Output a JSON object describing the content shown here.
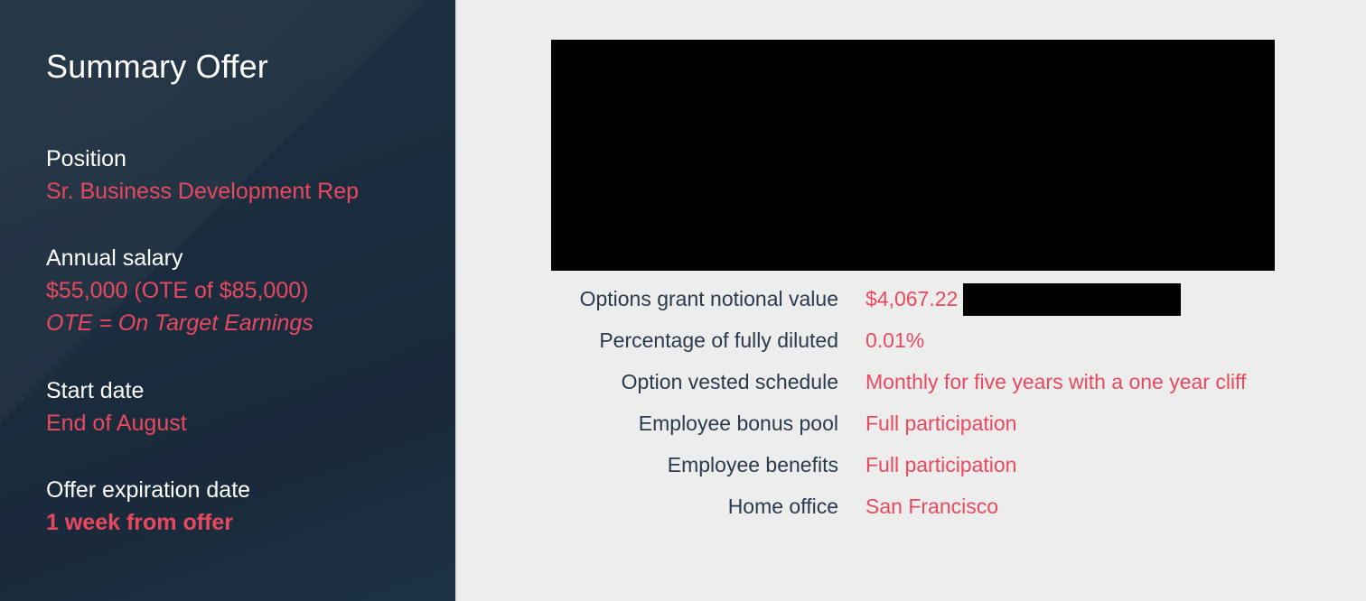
{
  "summary": {
    "title": "Summary Offer",
    "fields": [
      {
        "label": "Position",
        "value": "Sr. Business Development Rep"
      },
      {
        "label": "Annual salary",
        "value": "$55,000 (OTE of $85,000)",
        "note": "OTE = On Target Earnings"
      },
      {
        "label": "Start date",
        "value": "End of August"
      },
      {
        "label": "Offer expiration date",
        "value": "1 week from offer"
      }
    ]
  },
  "details": {
    "rows": [
      {
        "label": "Options grant notional value",
        "value": "$4,067.22 ("
      },
      {
        "label": "Percentage of fully diluted",
        "value": "0.01%"
      },
      {
        "label": "Option vested schedule",
        "value": "Monthly for five years with a one year cliff"
      },
      {
        "label": "Employee bonus pool",
        "value": "Full participation"
      },
      {
        "label": "Employee benefits",
        "value": "Full participation"
      },
      {
        "label": "Home office",
        "value": "San Francisco"
      }
    ]
  },
  "colors": {
    "accent": "#e8495f",
    "sidebar_bg": "#1b2c3e",
    "label_text": "#2b3a4d",
    "page_bg": "#ededed",
    "redaction": "#000000"
  }
}
